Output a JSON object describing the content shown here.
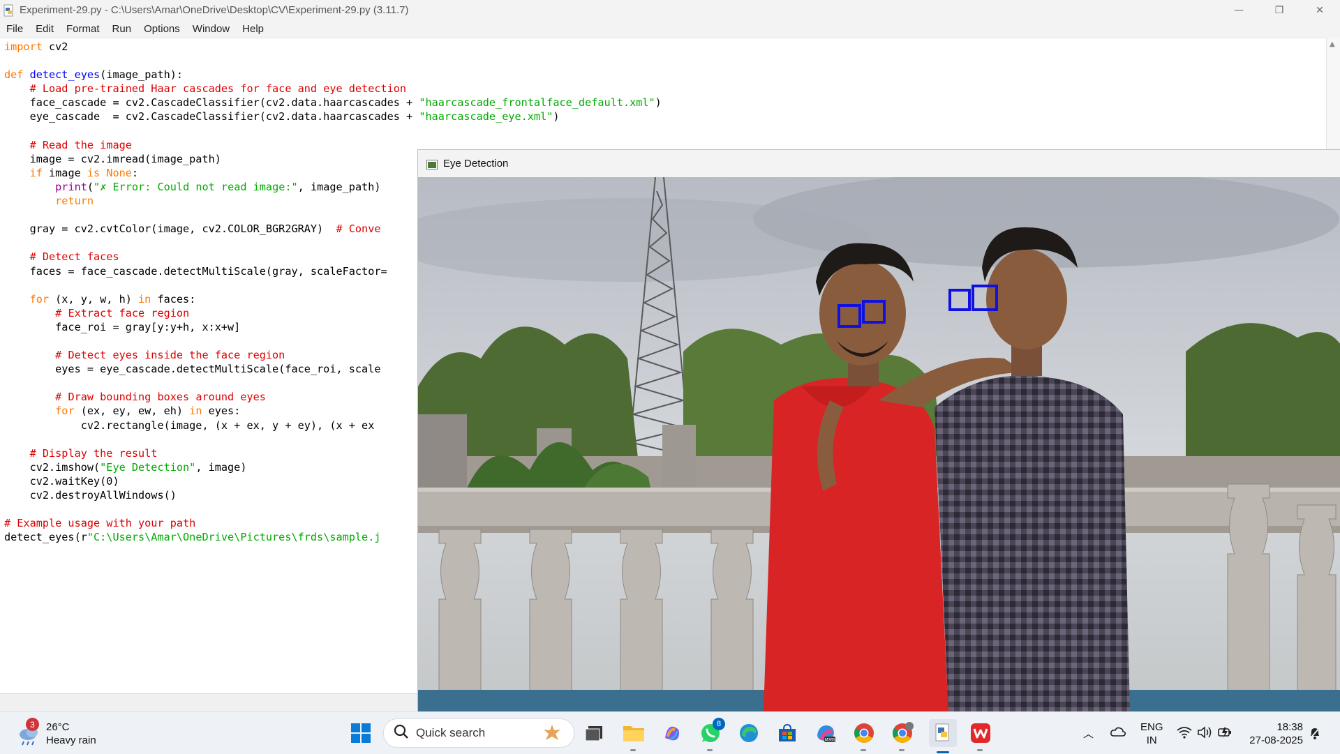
{
  "idle_window": {
    "title": "Experiment-29.py - C:\\Users\\Amar\\OneDrive\\Desktop\\CV\\Experiment-29.py (3.11.7)",
    "menu": [
      "File",
      "Edit",
      "Format",
      "Run",
      "Options",
      "Window",
      "Help"
    ],
    "controls": {
      "minimize": "—",
      "maximize": "❐",
      "close": "✕"
    }
  },
  "code_lines": [
    [
      {
        "t": "import",
        "c": "kw"
      },
      {
        "t": " cv2"
      }
    ],
    [],
    [
      {
        "t": "def",
        "c": "kw"
      },
      {
        "t": " "
      },
      {
        "t": "detect_eyes",
        "c": "fn"
      },
      {
        "t": "(image_path):"
      }
    ],
    [
      {
        "t": "    "
      },
      {
        "t": "# Load pre-trained Haar cascades for face and eye detection",
        "c": "cm"
      }
    ],
    [
      {
        "t": "    face_cascade = cv2.CascadeClassifier(cv2.data.haarcascades + "
      },
      {
        "t": "\"haarcascade_frontalface_default.xml\"",
        "c": "st"
      },
      {
        "t": ")"
      }
    ],
    [
      {
        "t": "    eye_cascade  = cv2.CascadeClassifier(cv2.data.haarcascades + "
      },
      {
        "t": "\"haarcascade_eye.xml\"",
        "c": "st"
      },
      {
        "t": ")"
      }
    ],
    [],
    [
      {
        "t": "    "
      },
      {
        "t": "# Read the image",
        "c": "cm"
      }
    ],
    [
      {
        "t": "    image = cv2.imread(image_path)"
      }
    ],
    [
      {
        "t": "    "
      },
      {
        "t": "if",
        "c": "kw"
      },
      {
        "t": " image "
      },
      {
        "t": "is",
        "c": "kw"
      },
      {
        "t": " "
      },
      {
        "t": "None",
        "c": "kw"
      },
      {
        "t": ":"
      }
    ],
    [
      {
        "t": "        "
      },
      {
        "t": "print",
        "c": "bi"
      },
      {
        "t": "("
      },
      {
        "t": "\"",
        "c": "st"
      },
      {
        "t": "✗",
        "c": "st"
      },
      {
        "t": " Error: Could not read image:\"",
        "c": "st"
      },
      {
        "t": ", image_path)"
      }
    ],
    [
      {
        "t": "        "
      },
      {
        "t": "return",
        "c": "kw"
      }
    ],
    [],
    [
      {
        "t": "    gray = cv2.cvtColor(image, cv2.COLOR_BGR2GRAY)  "
      },
      {
        "t": "# Conve",
        "c": "cm"
      }
    ],
    [],
    [
      {
        "t": "    "
      },
      {
        "t": "# Detect faces",
        "c": "cm"
      }
    ],
    [
      {
        "t": "    faces = face_cascade.detectMultiScale(gray, scaleFactor="
      }
    ],
    [],
    [
      {
        "t": "    "
      },
      {
        "t": "for",
        "c": "kw"
      },
      {
        "t": " (x, y, w, h) "
      },
      {
        "t": "in",
        "c": "kw"
      },
      {
        "t": " faces:"
      }
    ],
    [
      {
        "t": "        "
      },
      {
        "t": "# Extract face region",
        "c": "cm"
      }
    ],
    [
      {
        "t": "        face_roi = gray[y:y+h, x:x+w]"
      }
    ],
    [],
    [
      {
        "t": "        "
      },
      {
        "t": "# Detect eyes inside the face region",
        "c": "cm"
      }
    ],
    [
      {
        "t": "        eyes = eye_cascade.detectMultiScale(face_roi, scale"
      }
    ],
    [],
    [
      {
        "t": "        "
      },
      {
        "t": "# Draw bounding boxes around eyes",
        "c": "cm"
      }
    ],
    [
      {
        "t": "        "
      },
      {
        "t": "for",
        "c": "kw"
      },
      {
        "t": " (ex, ey, ew, eh) "
      },
      {
        "t": "in",
        "c": "kw"
      },
      {
        "t": " eyes:"
      }
    ],
    [
      {
        "t": "            cv2.rectangle(image, (x + ex, y + ey), (x + ex "
      }
    ],
    [],
    [
      {
        "t": "    "
      },
      {
        "t": "# Display the result",
        "c": "cm"
      }
    ],
    [
      {
        "t": "    cv2.imshow("
      },
      {
        "t": "\"Eye Detection\"",
        "c": "st"
      },
      {
        "t": ", image)"
      }
    ],
    [
      {
        "t": "    cv2.waitKey(0)"
      }
    ],
    [
      {
        "t": "    cv2.destroyAllWindows()"
      }
    ],
    [],
    [
      {
        "t": "# Example usage with your path",
        "c": "cm"
      }
    ],
    [
      {
        "t": "detect_eyes(r"
      },
      {
        "t": "\"C:\\Users\\Amar\\OneDrive\\Pictures\\frds\\sample.j",
        "c": "st"
      }
    ]
  ],
  "eye_window": {
    "title": "Eye Detection",
    "box_color": "#1010e0"
  },
  "taskbar": {
    "weather": {
      "temp": "26°C",
      "condition": "Heavy rain",
      "badge": "3"
    },
    "search_placeholder": "Quick search",
    "whatsapp_badge": "8",
    "apps": [
      "start",
      "search",
      "task-view",
      "file-explorer",
      "copilot",
      "whatsapp",
      "edge",
      "microsoft-store",
      "microsoft-365",
      "chrome",
      "chrome-profile",
      "python-idle",
      "wps-office"
    ],
    "lang": {
      "line1": "ENG",
      "line2": "IN"
    },
    "clock": {
      "time": "18:38",
      "date": "27-08-2025"
    }
  }
}
